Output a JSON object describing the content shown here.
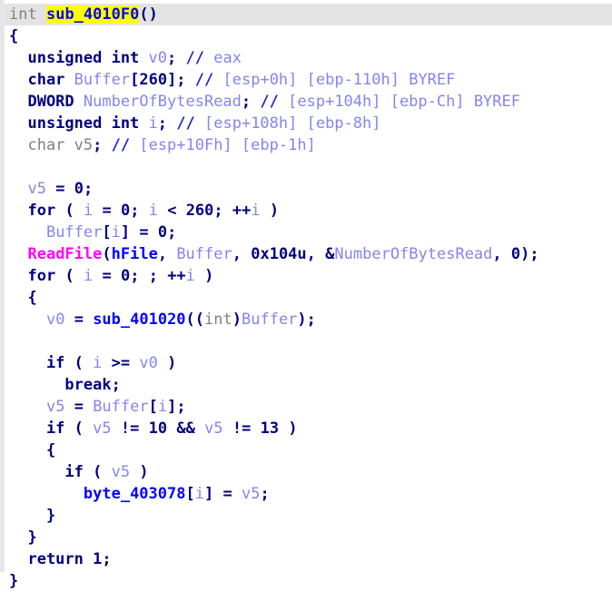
{
  "app": {
    "name": "IDA Hex-Rays Pseudocode",
    "view": "pseudocode-view"
  },
  "colors": {
    "background": "#ffffff",
    "current_line_background": "#e3e3e3",
    "highlight": "#ffff00",
    "keyword": "#00007f",
    "local_variable": "#8585ee",
    "comment": "#8585ee",
    "function": "#0000ff",
    "import": "#ff00ff",
    "global": "#0000ff",
    "dimmed_type": "#808080",
    "gutter": "#e6e6e8"
  },
  "function": {
    "return_type": "int",
    "name": "sub_4010F0",
    "signature": "int sub_4010F0()"
  },
  "highlighted_identifier": "sub_4010F0",
  "lines": [
    {
      "index": 0,
      "current": true,
      "tokens": [
        {
          "t": "gray",
          "s": "int"
        },
        {
          "t": "plain",
          "s": " "
        },
        {
          "t": "func",
          "s": "sub_4010F0",
          "hl": true
        },
        {
          "t": "punct",
          "s": "()"
        }
      ]
    },
    {
      "index": 1,
      "current": false,
      "tokens": [
        {
          "t": "punct",
          "s": "{"
        }
      ]
    },
    {
      "index": 2,
      "current": false,
      "tokens": [
        {
          "t": "keyword",
          "s": "  unsigned int"
        },
        {
          "t": "plain",
          "s": " "
        },
        {
          "t": "lvar",
          "s": "v0"
        },
        {
          "t": "punct",
          "s": ";"
        },
        {
          "t": "plain",
          "s": " "
        },
        {
          "t": "comment-mark",
          "s": "//"
        },
        {
          "t": "comment",
          "s": " eax"
        }
      ]
    },
    {
      "index": 3,
      "current": false,
      "tokens": [
        {
          "t": "keyword",
          "s": "  char"
        },
        {
          "t": "plain",
          "s": " "
        },
        {
          "t": "lvar",
          "s": "Buffer"
        },
        {
          "t": "punct",
          "s": "["
        },
        {
          "t": "number",
          "s": "260"
        },
        {
          "t": "punct",
          "s": "];"
        },
        {
          "t": "plain",
          "s": " "
        },
        {
          "t": "comment-mark",
          "s": "//"
        },
        {
          "t": "comment",
          "s": " [esp+0h] [ebp-110h] BYREF"
        }
      ]
    },
    {
      "index": 4,
      "current": false,
      "tokens": [
        {
          "t": "keyword",
          "s": "  DWORD"
        },
        {
          "t": "plain",
          "s": " "
        },
        {
          "t": "lvar",
          "s": "NumberOfBytesRead"
        },
        {
          "t": "punct",
          "s": ";"
        },
        {
          "t": "plain",
          "s": " "
        },
        {
          "t": "comment-mark",
          "s": "//"
        },
        {
          "t": "comment",
          "s": " [esp+104h] [ebp-Ch] BYREF"
        }
      ]
    },
    {
      "index": 5,
      "current": false,
      "tokens": [
        {
          "t": "keyword",
          "s": "  unsigned int"
        },
        {
          "t": "plain",
          "s": " "
        },
        {
          "t": "lvar",
          "s": "i"
        },
        {
          "t": "punct",
          "s": ";"
        },
        {
          "t": "plain",
          "s": " "
        },
        {
          "t": "comment-mark",
          "s": "//"
        },
        {
          "t": "comment",
          "s": " [esp+108h] [ebp-8h]"
        }
      ]
    },
    {
      "index": 6,
      "current": false,
      "tokens": [
        {
          "t": "gray",
          "s": "  char v5"
        },
        {
          "t": "punct",
          "s": ";"
        },
        {
          "t": "plain",
          "s": " "
        },
        {
          "t": "comment-mark",
          "s": "//"
        },
        {
          "t": "comment",
          "s": " [esp+10Fh] [ebp-1h]"
        }
      ]
    },
    {
      "index": 7,
      "current": false,
      "tokens": []
    },
    {
      "index": 8,
      "current": false,
      "tokens": [
        {
          "t": "plain",
          "s": "  "
        },
        {
          "t": "lvar",
          "s": "v5"
        },
        {
          "t": "plain",
          "s": " "
        },
        {
          "t": "punct",
          "s": "="
        },
        {
          "t": "plain",
          "s": " "
        },
        {
          "t": "number",
          "s": "0"
        },
        {
          "t": "punct",
          "s": ";"
        }
      ]
    },
    {
      "index": 9,
      "current": false,
      "tokens": [
        {
          "t": "keyword",
          "s": "  for"
        },
        {
          "t": "plain",
          "s": " "
        },
        {
          "t": "punct",
          "s": "("
        },
        {
          "t": "plain",
          "s": " "
        },
        {
          "t": "lvar",
          "s": "i"
        },
        {
          "t": "plain",
          "s": " "
        },
        {
          "t": "punct",
          "s": "="
        },
        {
          "t": "plain",
          "s": " "
        },
        {
          "t": "number",
          "s": "0"
        },
        {
          "t": "punct",
          "s": ";"
        },
        {
          "t": "plain",
          "s": " "
        },
        {
          "t": "lvar",
          "s": "i"
        },
        {
          "t": "plain",
          "s": " "
        },
        {
          "t": "punct",
          "s": "<"
        },
        {
          "t": "plain",
          "s": " "
        },
        {
          "t": "number",
          "s": "260"
        },
        {
          "t": "punct",
          "s": ";"
        },
        {
          "t": "plain",
          "s": " "
        },
        {
          "t": "punct",
          "s": "++"
        },
        {
          "t": "lvar",
          "s": "i"
        },
        {
          "t": "plain",
          "s": " "
        },
        {
          "t": "punct",
          "s": ")"
        }
      ]
    },
    {
      "index": 10,
      "current": false,
      "tokens": [
        {
          "t": "plain",
          "s": "    "
        },
        {
          "t": "lvar",
          "s": "Buffer"
        },
        {
          "t": "punct",
          "s": "["
        },
        {
          "t": "lvar",
          "s": "i"
        },
        {
          "t": "punct",
          "s": "]"
        },
        {
          "t": "plain",
          "s": " "
        },
        {
          "t": "punct",
          "s": "="
        },
        {
          "t": "plain",
          "s": " "
        },
        {
          "t": "number",
          "s": "0"
        },
        {
          "t": "punct",
          "s": ";"
        }
      ]
    },
    {
      "index": 11,
      "current": false,
      "tokens": [
        {
          "t": "plain",
          "s": "  "
        },
        {
          "t": "import",
          "s": "ReadFile"
        },
        {
          "t": "punct",
          "s": "("
        },
        {
          "t": "global",
          "s": "hFile"
        },
        {
          "t": "punct",
          "s": ","
        },
        {
          "t": "plain",
          "s": " "
        },
        {
          "t": "lvar",
          "s": "Buffer"
        },
        {
          "t": "punct",
          "s": ","
        },
        {
          "t": "plain",
          "s": " "
        },
        {
          "t": "number",
          "s": "0x104u"
        },
        {
          "t": "punct",
          "s": ","
        },
        {
          "t": "plain",
          "s": " "
        },
        {
          "t": "punct",
          "s": "&"
        },
        {
          "t": "lvar",
          "s": "NumberOfBytesRead"
        },
        {
          "t": "punct",
          "s": ","
        },
        {
          "t": "plain",
          "s": " "
        },
        {
          "t": "number",
          "s": "0"
        },
        {
          "t": "punct",
          "s": ");"
        }
      ]
    },
    {
      "index": 12,
      "current": false,
      "tokens": [
        {
          "t": "keyword",
          "s": "  for"
        },
        {
          "t": "plain",
          "s": " "
        },
        {
          "t": "punct",
          "s": "("
        },
        {
          "t": "plain",
          "s": " "
        },
        {
          "t": "lvar",
          "s": "i"
        },
        {
          "t": "plain",
          "s": " "
        },
        {
          "t": "punct",
          "s": "="
        },
        {
          "t": "plain",
          "s": " "
        },
        {
          "t": "number",
          "s": "0"
        },
        {
          "t": "punct",
          "s": ";"
        },
        {
          "t": "plain",
          "s": " "
        },
        {
          "t": "punct",
          "s": ";"
        },
        {
          "t": "plain",
          "s": " "
        },
        {
          "t": "punct",
          "s": "++"
        },
        {
          "t": "lvar",
          "s": "i"
        },
        {
          "t": "plain",
          "s": " "
        },
        {
          "t": "punct",
          "s": ")"
        }
      ]
    },
    {
      "index": 13,
      "current": false,
      "tokens": [
        {
          "t": "punct",
          "s": "  {"
        }
      ]
    },
    {
      "index": 14,
      "current": false,
      "tokens": [
        {
          "t": "plain",
          "s": "    "
        },
        {
          "t": "lvar",
          "s": "v0"
        },
        {
          "t": "plain",
          "s": " "
        },
        {
          "t": "punct",
          "s": "="
        },
        {
          "t": "plain",
          "s": " "
        },
        {
          "t": "func",
          "s": "sub_401020"
        },
        {
          "t": "punct",
          "s": "(("
        },
        {
          "t": "gray",
          "s": "int"
        },
        {
          "t": "punct",
          "s": ")"
        },
        {
          "t": "lvar",
          "s": "Buffer"
        },
        {
          "t": "punct",
          "s": ");"
        }
      ]
    },
    {
      "index": 15,
      "current": false,
      "tokens": []
    },
    {
      "index": 16,
      "current": false,
      "tokens": [
        {
          "t": "keyword",
          "s": "    if"
        },
        {
          "t": "plain",
          "s": " "
        },
        {
          "t": "punct",
          "s": "("
        },
        {
          "t": "plain",
          "s": " "
        },
        {
          "t": "lvar",
          "s": "i"
        },
        {
          "t": "plain",
          "s": " "
        },
        {
          "t": "punct",
          "s": ">="
        },
        {
          "t": "plain",
          "s": " "
        },
        {
          "t": "lvar",
          "s": "v0"
        },
        {
          "t": "plain",
          "s": " "
        },
        {
          "t": "punct",
          "s": ")"
        }
      ]
    },
    {
      "index": 17,
      "current": false,
      "tokens": [
        {
          "t": "keyword",
          "s": "      break"
        },
        {
          "t": "punct",
          "s": ";"
        }
      ]
    },
    {
      "index": 18,
      "current": false,
      "tokens": [
        {
          "t": "plain",
          "s": "    "
        },
        {
          "t": "lvar",
          "s": "v5"
        },
        {
          "t": "plain",
          "s": " "
        },
        {
          "t": "punct",
          "s": "="
        },
        {
          "t": "plain",
          "s": " "
        },
        {
          "t": "lvar",
          "s": "Buffer"
        },
        {
          "t": "punct",
          "s": "["
        },
        {
          "t": "lvar",
          "s": "i"
        },
        {
          "t": "punct",
          "s": "];"
        }
      ]
    },
    {
      "index": 19,
      "current": false,
      "tokens": [
        {
          "t": "keyword",
          "s": "    if"
        },
        {
          "t": "plain",
          "s": " "
        },
        {
          "t": "punct",
          "s": "("
        },
        {
          "t": "plain",
          "s": " "
        },
        {
          "t": "lvar",
          "s": "v5"
        },
        {
          "t": "plain",
          "s": " "
        },
        {
          "t": "punct",
          "s": "!="
        },
        {
          "t": "plain",
          "s": " "
        },
        {
          "t": "number",
          "s": "10"
        },
        {
          "t": "plain",
          "s": " "
        },
        {
          "t": "punct",
          "s": "&&"
        },
        {
          "t": "plain",
          "s": " "
        },
        {
          "t": "lvar",
          "s": "v5"
        },
        {
          "t": "plain",
          "s": " "
        },
        {
          "t": "punct",
          "s": "!="
        },
        {
          "t": "plain",
          "s": " "
        },
        {
          "t": "number",
          "s": "13"
        },
        {
          "t": "plain",
          "s": " "
        },
        {
          "t": "punct",
          "s": ")"
        }
      ]
    },
    {
      "index": 20,
      "current": false,
      "tokens": [
        {
          "t": "punct",
          "s": "    {"
        }
      ]
    },
    {
      "index": 21,
      "current": false,
      "tokens": [
        {
          "t": "keyword",
          "s": "      if"
        },
        {
          "t": "plain",
          "s": " "
        },
        {
          "t": "punct",
          "s": "("
        },
        {
          "t": "plain",
          "s": " "
        },
        {
          "t": "lvar",
          "s": "v5"
        },
        {
          "t": "plain",
          "s": " "
        },
        {
          "t": "punct",
          "s": ")"
        }
      ]
    },
    {
      "index": 22,
      "current": false,
      "tokens": [
        {
          "t": "plain",
          "s": "        "
        },
        {
          "t": "global",
          "s": "byte_403078"
        },
        {
          "t": "punct",
          "s": "["
        },
        {
          "t": "lvar",
          "s": "i"
        },
        {
          "t": "punct",
          "s": "]"
        },
        {
          "t": "plain",
          "s": " "
        },
        {
          "t": "punct",
          "s": "="
        },
        {
          "t": "plain",
          "s": " "
        },
        {
          "t": "lvar",
          "s": "v5"
        },
        {
          "t": "punct",
          "s": ";"
        }
      ]
    },
    {
      "index": 23,
      "current": false,
      "tokens": [
        {
          "t": "punct",
          "s": "    }"
        }
      ]
    },
    {
      "index": 24,
      "current": false,
      "tokens": [
        {
          "t": "punct",
          "s": "  }"
        }
      ]
    },
    {
      "index": 25,
      "current": false,
      "tokens": [
        {
          "t": "keyword",
          "s": "  return"
        },
        {
          "t": "plain",
          "s": " "
        },
        {
          "t": "number",
          "s": "1"
        },
        {
          "t": "punct",
          "s": ";"
        }
      ]
    },
    {
      "index": 26,
      "current": false,
      "tokens": [
        {
          "t": "punct",
          "s": "}"
        }
      ]
    }
  ],
  "plain_text": [
    "int sub_4010F0()",
    "{",
    "  unsigned int v0; // eax",
    "  char Buffer[260]; // [esp+0h] [ebp-110h] BYREF",
    "  DWORD NumberOfBytesRead; // [esp+104h] [ebp-Ch] BYREF",
    "  unsigned int i; // [esp+108h] [ebp-8h]",
    "  char v5; // [esp+10Fh] [ebp-1h]",
    "",
    "  v5 = 0;",
    "  for ( i = 0; i < 260; ++i )",
    "    Buffer[i] = 0;",
    "  ReadFile(hFile, Buffer, 0x104u, &NumberOfBytesRead, 0);",
    "  for ( i = 0; ; ++i )",
    "  {",
    "    v0 = sub_401020((int)Buffer);",
    "",
    "    if ( i >= v0 )",
    "      break;",
    "    v5 = Buffer[i];",
    "    if ( v5 != 10 && v5 != 13 )",
    "    {",
    "      if ( v5 )",
    "        byte_403078[i] = v5;",
    "    }",
    "  }",
    "  return 1;",
    "}"
  ]
}
